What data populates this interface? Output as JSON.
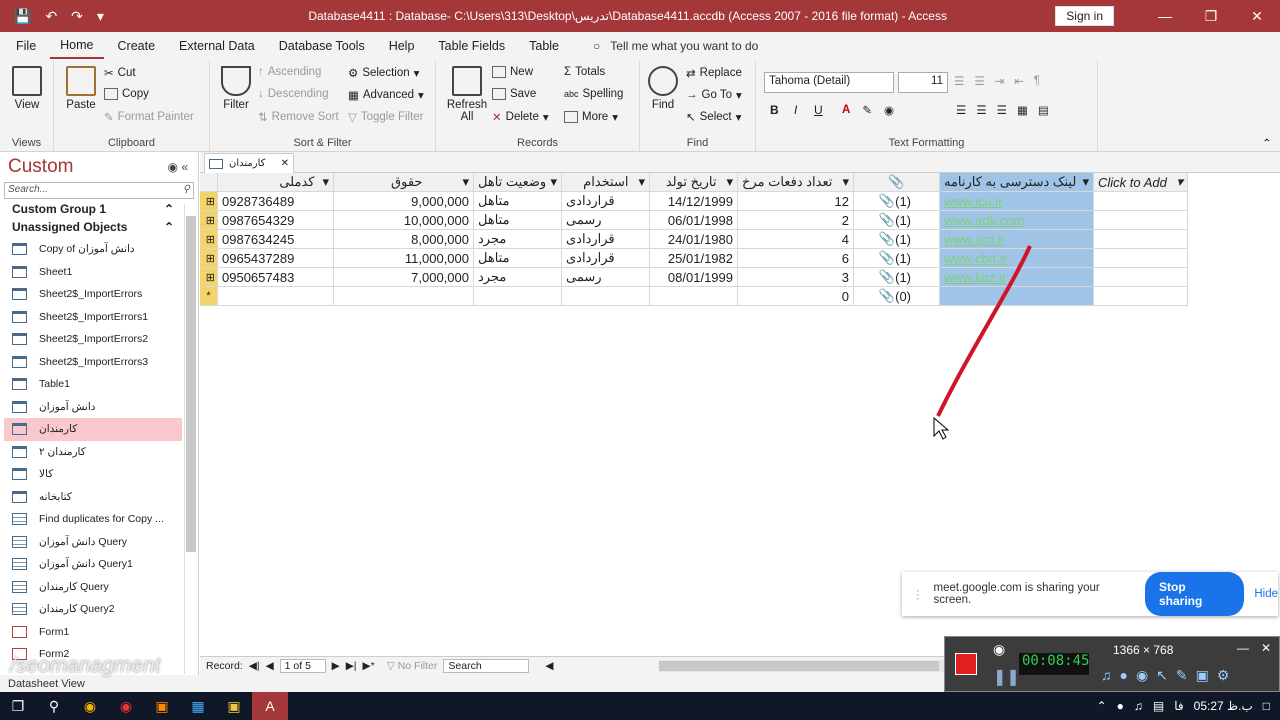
{
  "window": {
    "title": "Database4411 : Database- C:\\Users\\313\\Desktop\\تدریس\\Database4411.accdb (Access 2007 - 2016 file format) - Access",
    "signin": "Sign in"
  },
  "tabs": [
    "File",
    "Home",
    "Create",
    "External Data",
    "Database Tools",
    "Help",
    "Table Fields",
    "Table"
  ],
  "tell": "Tell me what you want to do",
  "ribbon": {
    "views": {
      "view": "View",
      "label": "Views"
    },
    "clipboard": {
      "paste": "Paste",
      "cut": "Cut",
      "copy": "Copy",
      "painter": "Format Painter",
      "label": "Clipboard"
    },
    "sort": {
      "filter": "Filter",
      "asc": "Ascending",
      "desc": "Descending",
      "remove": "Remove Sort",
      "selection": "Selection",
      "advanced": "Advanced",
      "toggle": "Toggle Filter",
      "label": "Sort & Filter"
    },
    "records": {
      "refresh": "Refresh All",
      "new": "New",
      "save": "Save",
      "delete": "Delete",
      "totals": "Totals",
      "spelling": "Spelling",
      "more": "More",
      "label": "Records"
    },
    "find": {
      "find": "Find",
      "replace": "Replace",
      "goto": "Go To",
      "select": "Select",
      "label": "Find"
    },
    "text": {
      "font": "Tahoma (Detail)",
      "size": "11",
      "label": "Text Formatting",
      "bold": "B",
      "italic": "I",
      "underline": "U"
    }
  },
  "nav": {
    "title": "Custom",
    "search": "Search...",
    "group1": "Custom Group 1",
    "group2": "Unassigned Objects",
    "items": [
      {
        "label": "Copy of دانش آموزان",
        "type": "table"
      },
      {
        "label": "Sheet1",
        "type": "table"
      },
      {
        "label": "Sheet2$_ImportErrors",
        "type": "table"
      },
      {
        "label": "Sheet2$_ImportErrors1",
        "type": "table"
      },
      {
        "label": "Sheet2$_ImportErrors2",
        "type": "table"
      },
      {
        "label": "Sheet2$_ImportErrors3",
        "type": "table"
      },
      {
        "label": "Table1",
        "type": "table"
      },
      {
        "label": "دانش آموزان",
        "type": "table"
      },
      {
        "label": "کارمندان",
        "type": "table",
        "selected": true
      },
      {
        "label": "کارمندان ۲",
        "type": "table"
      },
      {
        "label": "کالا",
        "type": "table"
      },
      {
        "label": "کتابخانه",
        "type": "table"
      },
      {
        "label": "Find duplicates for Copy ...",
        "type": "query"
      },
      {
        "label": "دانش آموزان Query",
        "type": "query"
      },
      {
        "label": "دانش آموزان Query1",
        "type": "query"
      },
      {
        "label": "کارمندان Query",
        "type": "query"
      },
      {
        "label": "کارمندان Query2",
        "type": "query"
      },
      {
        "label": "Form1",
        "type": "form"
      },
      {
        "label": "Form2",
        "type": "form"
      }
    ]
  },
  "doc_tab": "کارمندان",
  "table": {
    "headers": [
      "کدملی",
      "حقوق",
      "وضعیت تاهل",
      "استخدام",
      "تاریخ تولد",
      "تعداد دفعات مرخ",
      "📎",
      "لینک دسترسی به کارنامه",
      "Click to Add"
    ],
    "rows": [
      [
        "0928736489",
        "9,000,000",
        "متاهل",
        "قراردادی",
        "14/12/1999",
        "12",
        "(1)",
        "www.icu.ir"
      ],
      [
        "0987654329",
        "10,000,000",
        "متاهل",
        "رسمی",
        "06/01/1998",
        "2",
        "(1)",
        "www.adk.com"
      ],
      [
        "0987634245",
        "8,000,000",
        "مجرد",
        "قراردادی",
        "24/01/1980",
        "4",
        "(1)",
        "www.ard.ir"
      ],
      [
        "0965437289",
        "11,000,000",
        "متاهل",
        "قراردادی",
        "25/01/1982",
        "6",
        "(1)",
        "www.cbd.ir"
      ],
      [
        "0950657483",
        "7,000,000",
        "مجرد",
        "رسمی",
        "08/01/1999",
        "3",
        "(1)",
        "www.koz.ir"
      ]
    ],
    "new_row": {
      "count": "0",
      "attach": "(0)"
    }
  },
  "record_nav": {
    "label": "Record:",
    "pos": "1 of 5",
    "nofilter": "No Filter",
    "search": "Search"
  },
  "status": "Datasheet View",
  "share": {
    "text": "meet.google.com is sharing your screen.",
    "stop": "Stop sharing",
    "hide": "Hide"
  },
  "recorder": {
    "time": "00:08:45",
    "res": "1366 × 768"
  },
  "watermark": "/seomanagment",
  "clock": "05:27 ب.ظ",
  "lang": "فا"
}
